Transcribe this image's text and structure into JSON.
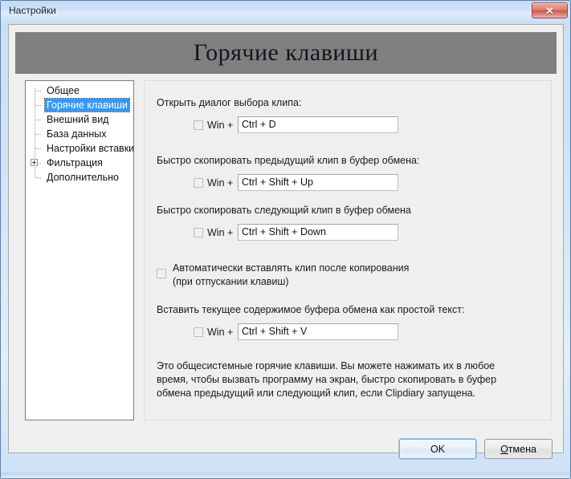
{
  "window": {
    "title": "Настройки",
    "close_label": "✕"
  },
  "header": {
    "title": "Горячие клавиши"
  },
  "sidebar": {
    "items": [
      {
        "label": "Общее",
        "selected": false,
        "expandable": false
      },
      {
        "label": "Горячие клавиши",
        "selected": true,
        "expandable": false
      },
      {
        "label": "Внешний вид",
        "selected": false,
        "expandable": false
      },
      {
        "label": "База данных",
        "selected": false,
        "expandable": false
      },
      {
        "label": "Настройки вставки",
        "selected": false,
        "expandable": false
      },
      {
        "label": "Фильтрация",
        "selected": false,
        "expandable": true
      },
      {
        "label": "Дополнительно",
        "selected": false,
        "expandable": false
      }
    ]
  },
  "main": {
    "hotkeys": [
      {
        "label": "Открыть диалог выбора клипа:",
        "win_label": "Win +",
        "win_checked": false,
        "value": "Ctrl + D"
      },
      {
        "label": "Быстро скопировать предыдущий клип в буфер обмена:",
        "win_label": "Win +",
        "win_checked": false,
        "value": "Ctrl + Shift + Up"
      },
      {
        "label": "Быстро скопировать следующий клип в буфер обмена",
        "win_label": "Win +",
        "win_checked": false,
        "value": "Ctrl + Shift + Down"
      },
      {
        "label": "Вставить текущее содержимое буфера обмена как простой текст:",
        "win_label": "Win +",
        "win_checked": false,
        "value": "Ctrl + Shift + V"
      }
    ],
    "autopaste": {
      "line1": "Автоматически вставлять клип после копирования",
      "line2": "(при отпускании клавиш)",
      "checked": false
    },
    "description": "Это общесистемные горячие клавиши. Вы можете нажимать их в любое время, чтобы вызвать программу на экран, быстро скопировать в буфер обмена предыдущий или следующий клип, если Clipdiary запущена."
  },
  "footer": {
    "ok_label": "OK",
    "cancel_accel": "О",
    "cancel_rest": "тмена"
  },
  "colors": {
    "selection": "#3399ff",
    "header_bg": "#808080",
    "close_button": "#c75a4c"
  }
}
